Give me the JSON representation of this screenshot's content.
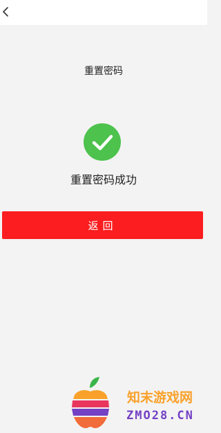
{
  "header": {
    "back_icon": "chevron-left-icon"
  },
  "page": {
    "title": "重置密码"
  },
  "result": {
    "icon": "check-circle-icon",
    "icon_color": "#4dc24d",
    "message": "重置密码成功"
  },
  "actions": {
    "return_label": "返回",
    "return_color": "#fb1d1f"
  },
  "watermark": {
    "logo_icon": "apple-logo-icon",
    "site_name_cn": "知末游戏网",
    "site_domain": "ZMO28.CN",
    "brand_colors": [
      "#f9a12a",
      "#7440c4",
      "#3bb54a",
      "#e8365d"
    ]
  }
}
